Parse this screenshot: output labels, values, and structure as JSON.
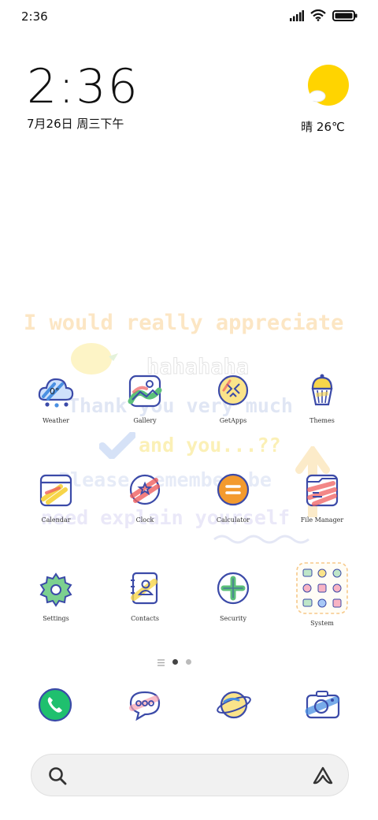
{
  "status_bar": {
    "time": "2:36"
  },
  "clock_widget": {
    "time": "2:36",
    "date": "7月26日 周三下午"
  },
  "weather_widget": {
    "text": "晴 26℃"
  },
  "wallpaper": {
    "lines": [
      "I would really appreciate",
      "hahahaha",
      "Thank you very much",
      "and you...??",
      "Please remember be",
      "need explain yourself"
    ]
  },
  "apps": {
    "weather": "Weather",
    "gallery": "Gallery",
    "getapps": "GetApps",
    "themes": "Themes",
    "calendar": "Calendar",
    "clock": "Clock",
    "calculator": "Calculator",
    "file_manager": "File Manager",
    "settings": "Settings",
    "contacts": "Contacts",
    "security": "Security",
    "system": "System"
  },
  "page_indicator": {
    "pages": 3,
    "current": 1
  },
  "colors": {
    "outline": "#3b4aa8",
    "yellow": "#f7d54a",
    "red": "#f06060",
    "green": "#5cc07a",
    "blue": "#4a90e2",
    "orange": "#f39a2e"
  }
}
